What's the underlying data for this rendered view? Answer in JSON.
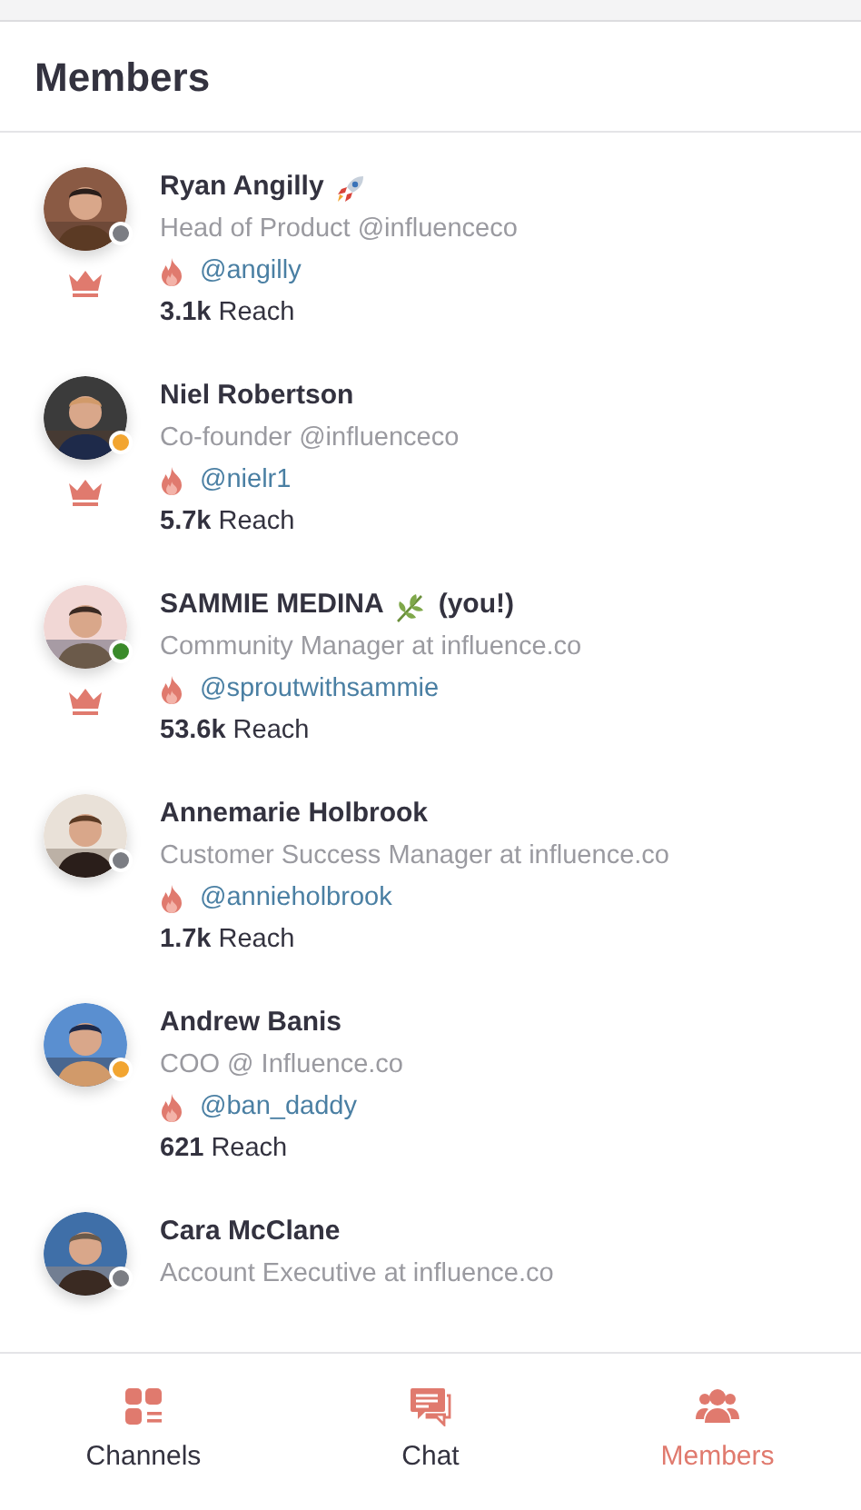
{
  "header": {
    "title": "Members"
  },
  "members": [
    {
      "kind": "rocket",
      "name": "Ryan Angilly",
      "title": "Head of Product @influenceco",
      "handle": "@angilly",
      "reach": "3.1k",
      "reach_label": "Reach",
      "color": "#7b7d83",
      "admin": true
    },
    {
      "kind": "plain",
      "name": "Niel Robertson",
      "title": "Co-founder @influenceco",
      "handle": "@nielr1",
      "reach": "5.7k",
      "reach_label": "Reach",
      "color": "#f2a531",
      "admin": true
    },
    {
      "kind": "leaf",
      "name": "SAMMIE MEDINA",
      "suffix": "(you!)",
      "title": "Community Manager at influence.co",
      "handle": "@sproutwithsammie",
      "reach": "53.6k",
      "reach_label": "Reach",
      "color": "#3a8a2a",
      "admin": true
    },
    {
      "kind": "plain",
      "name": "Annemarie Holbrook",
      "title": "Customer Success Manager at influence.co",
      "handle": "@annieholbrook",
      "reach": "1.7k",
      "reach_label": "Reach",
      "color": "#7b7d83",
      "admin": false
    },
    {
      "kind": "plain",
      "name": "Andrew Banis",
      "title": "COO @ Influence.co",
      "handle": "@ban_daddy",
      "reach": "621",
      "reach_label": "Reach",
      "color": "#f2a531",
      "admin": false
    },
    {
      "kind": "plain",
      "name": "Cara McClane",
      "title": "Account Executive at influence.co",
      "color": "#7b7d83",
      "admin": false
    }
  ],
  "tabs": [
    {
      "label": "Channels",
      "selected": false
    },
    {
      "label": "Chat",
      "selected": false
    },
    {
      "label": "Members",
      "selected": true
    }
  ]
}
